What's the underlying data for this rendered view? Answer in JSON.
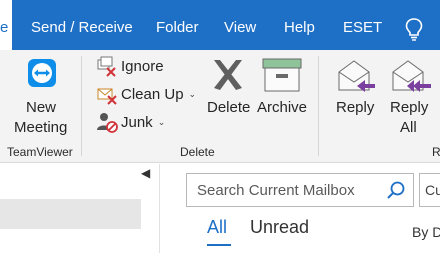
{
  "tabs": [
    {
      "label": "e",
      "active": true
    },
    {
      "label": "Send / Receive",
      "active": false
    },
    {
      "label": "Folder",
      "active": false
    },
    {
      "label": "View",
      "active": false
    },
    {
      "label": "Help",
      "active": false
    },
    {
      "label": "ESET",
      "active": false
    }
  ],
  "ribbon": {
    "teamviewer": {
      "new_meeting_line1": "New",
      "new_meeting_line2": "Meeting",
      "group_label": "TeamViewer"
    },
    "delete_group": {
      "ignore_label": "Ignore",
      "cleanup_label": "Clean Up",
      "junk_label": "Junk",
      "delete_label": "Delete",
      "archive_label": "Archive",
      "group_label": "Delete"
    },
    "respond_group": {
      "reply_label": "Reply",
      "reply_all_line1": "Reply",
      "reply_all_line2": "All",
      "group_label_partial": "R"
    }
  },
  "search": {
    "placeholder": "Search Current Mailbox",
    "scope_partial": "Cu"
  },
  "filters": {
    "all": "All",
    "unread": "Unread",
    "sort_partial": "By D"
  },
  "colors": {
    "accent": "#1e6fc6",
    "ribbon_bg": "#f3f3f3",
    "reply_arrow": "#7b3fa0"
  }
}
